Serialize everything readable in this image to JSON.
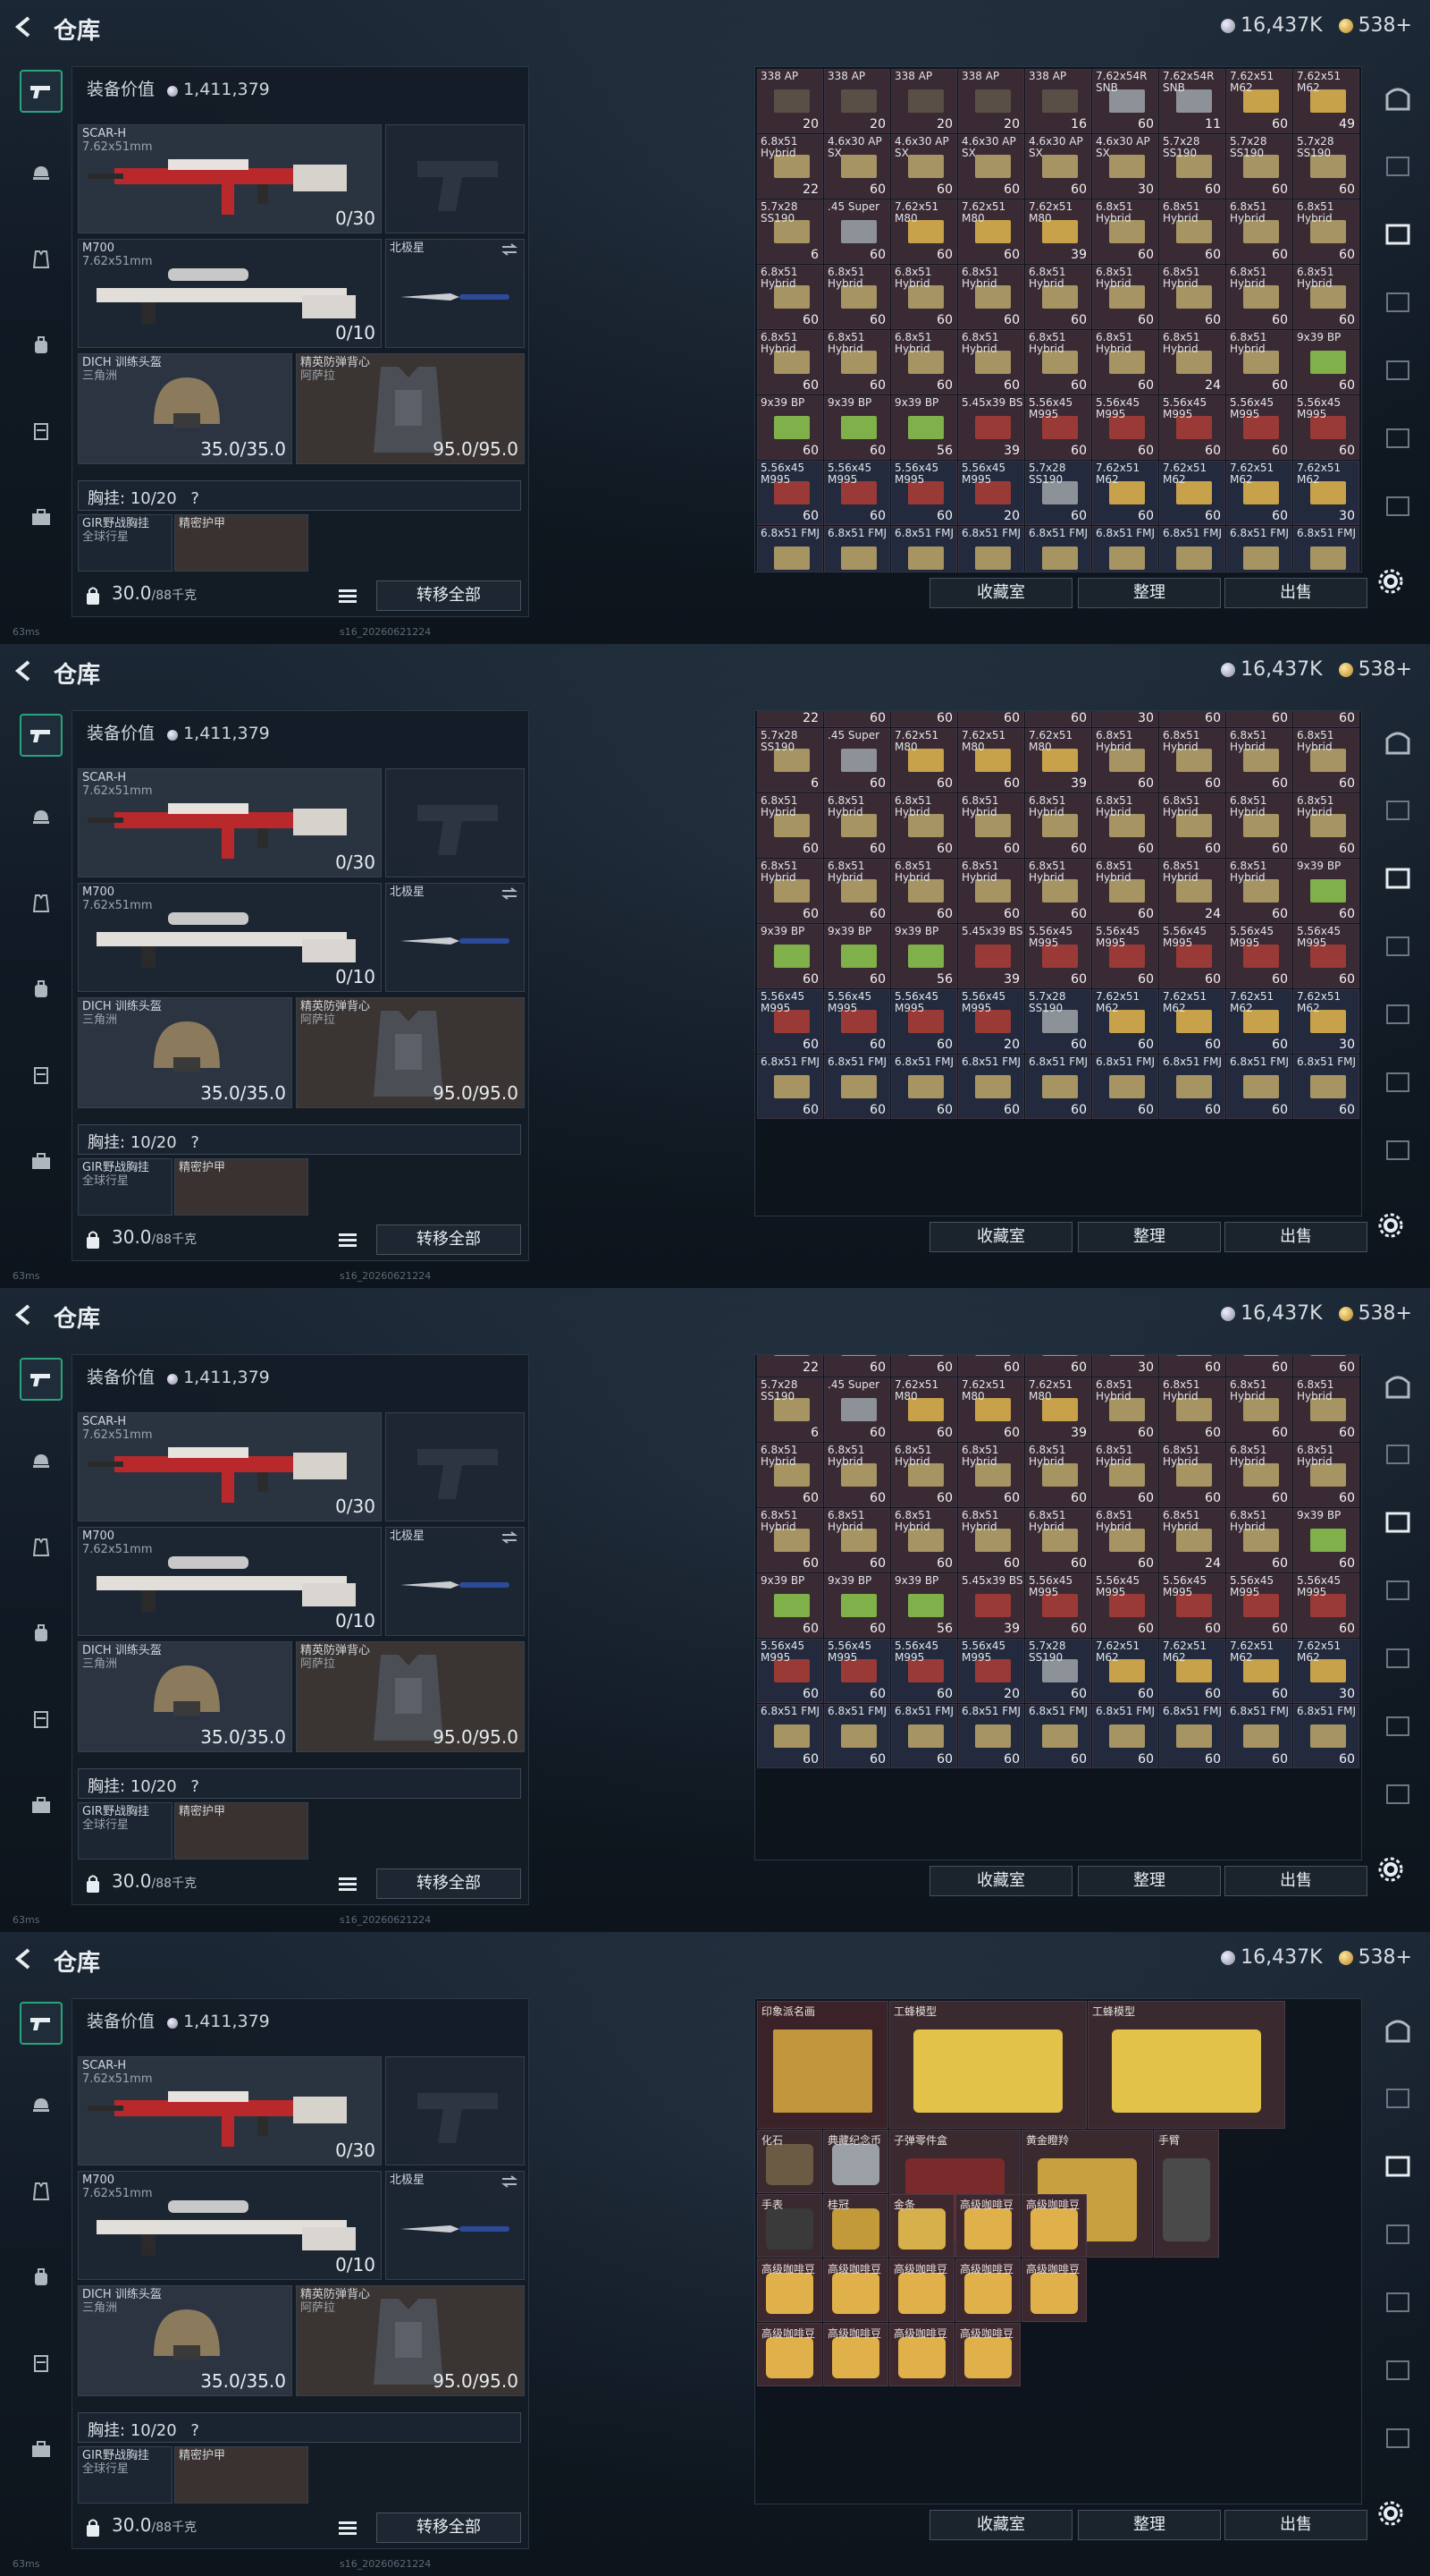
{
  "app": {
    "title": "仓库",
    "currency_silver": "16,437K",
    "currency_gold": "538+"
  },
  "loadout": {
    "value_label": "装备价值",
    "value": "1,411,379",
    "primary": {
      "name": "SCAR-H",
      "caliber": "7.62x51mm",
      "ammo": "0/30"
    },
    "secondary": {
      "name": "M700",
      "caliber": "7.62x51mm",
      "ammo": "0/10"
    },
    "melee": {
      "name": "北极星"
    },
    "helmet": {
      "name": "DICH 训练头盔",
      "sub": "三角洲",
      "durability": "35.0/35.0"
    },
    "armor": {
      "name": "精英防弹背心",
      "sub": "阿萨拉",
      "durability": "95.0/95.0"
    },
    "chest": {
      "label": "胸挂:",
      "value": "10/20",
      "help": "?"
    },
    "rig_item_1": "GIR野战胸挂",
    "rig_item_1_sub": "全球行星",
    "rig_item_2": "精密护甲",
    "weight": "30.0",
    "weight_max": "/88千克",
    "transfer_all": "转移全部"
  },
  "inventory_buttons": {
    "collect": "收藏室",
    "sort": "整理",
    "sell": "出售"
  },
  "status": {
    "ping": "63ms",
    "build": "s16_20260621224"
  },
  "panels": [
    {
      "rows": [
        [
          [
            "338 AP",
            "20",
            "ap"
          ],
          [
            "338 AP",
            "20",
            "ap"
          ],
          [
            "338 AP",
            "20",
            "ap"
          ],
          [
            "338 AP",
            "20",
            "ap"
          ],
          [
            "338 AP",
            "16",
            "ap"
          ],
          [
            "7.62x54R SNB",
            "60",
            "silver"
          ],
          [
            "7.62x54R SNB",
            "11",
            "silver"
          ],
          [
            "7.62x51 M62",
            "60",
            "gold"
          ],
          [
            "7.62x51 M62",
            "49",
            "gold"
          ]
        ],
        [
          [
            "6.8x51 Hybrid",
            "22",
            "tan"
          ],
          [
            "4.6x30 AP SX",
            "60",
            "tan"
          ],
          [
            "4.6x30 AP SX",
            "60",
            "tan"
          ],
          [
            "4.6x30 AP SX",
            "60",
            "tan"
          ],
          [
            "4.6x30 AP SX",
            "60",
            "tan"
          ],
          [
            "4.6x30 AP SX",
            "30",
            "tan"
          ],
          [
            "5.7x28 SS190",
            "60",
            "tan"
          ],
          [
            "5.7x28 SS190",
            "60",
            "tan"
          ],
          [
            "5.7x28 SS190",
            "60",
            "tan"
          ]
        ],
        [
          [
            "5.7x28 SS190",
            "6",
            "tan"
          ],
          [
            ".45 Super",
            "60",
            "silver"
          ],
          [
            "7.62x51 M80",
            "60",
            "gold"
          ],
          [
            "7.62x51 M80",
            "60",
            "gold"
          ],
          [
            "7.62x51 M80",
            "39",
            "gold"
          ],
          [
            "6.8x51 Hybrid",
            "60",
            "tan"
          ],
          [
            "6.8x51 Hybrid",
            "60",
            "tan"
          ],
          [
            "6.8x51 Hybrid",
            "60",
            "tan"
          ],
          [
            "6.8x51 Hybrid",
            "60",
            "tan"
          ]
        ],
        [
          [
            "6.8x51 Hybrid",
            "60",
            "tan"
          ],
          [
            "6.8x51 Hybrid",
            "60",
            "tan"
          ],
          [
            "6.8x51 Hybrid",
            "60",
            "tan"
          ],
          [
            "6.8x51 Hybrid",
            "60",
            "tan"
          ],
          [
            "6.8x51 Hybrid",
            "60",
            "tan"
          ],
          [
            "6.8x51 Hybrid",
            "60",
            "tan"
          ],
          [
            "6.8x51 Hybrid",
            "60",
            "tan"
          ],
          [
            "6.8x51 Hybrid",
            "60",
            "tan"
          ],
          [
            "6.8x51 Hybrid",
            "60",
            "tan"
          ]
        ],
        [
          [
            "6.8x51 Hybrid",
            "60",
            "tan"
          ],
          [
            "6.8x51 Hybrid",
            "60",
            "tan"
          ],
          [
            "6.8x51 Hybrid",
            "60",
            "tan"
          ],
          [
            "6.8x51 Hybrid",
            "60",
            "tan"
          ],
          [
            "6.8x51 Hybrid",
            "60",
            "tan"
          ],
          [
            "6.8x51 Hybrid",
            "60",
            "tan"
          ],
          [
            "6.8x51 Hybrid",
            "24",
            "tan"
          ],
          [
            "6.8x51 Hybrid",
            "60",
            "tan"
          ],
          [
            "9x39 BP",
            "60",
            "green"
          ]
        ],
        [
          [
            "9x39 BP",
            "60",
            "green"
          ],
          [
            "9x39 BP",
            "60",
            "green"
          ],
          [
            "9x39 BP",
            "56",
            "green"
          ],
          [
            "5.45x39 BS",
            "39",
            "red"
          ],
          [
            "5.56x45 M995",
            "60",
            "red"
          ],
          [
            "5.56x45 M995",
            "60",
            "red"
          ],
          [
            "5.56x45 M995",
            "60",
            "red"
          ],
          [
            "5.56x45 M995",
            "60",
            "red"
          ],
          [
            "5.56x45 M995",
            "60",
            "red"
          ]
        ],
        [
          [
            "5.56x45 M995",
            "60",
            "red"
          ],
          [
            "5.56x45 M995",
            "60",
            "red"
          ],
          [
            "5.56x45 M995",
            "60",
            "red"
          ],
          [
            "5.56x45 M995",
            "20",
            "red"
          ],
          [
            "5.7x28 SS190",
            "60",
            "silver"
          ],
          [
            "7.62x51 M62",
            "60",
            "gold"
          ],
          [
            "7.62x51 M62",
            "60",
            "gold"
          ],
          [
            "7.62x51 M62",
            "60",
            "gold"
          ],
          [
            "7.62x51 M62",
            "30",
            "gold"
          ]
        ],
        [
          [
            "6.8x51 FMJ",
            "60",
            "tan"
          ],
          [
            "6.8x51 FMJ",
            "60",
            "tan"
          ],
          [
            "6.8x51 FMJ",
            "60",
            "tan"
          ],
          [
            "6.8x51 FMJ",
            "60",
            "tan"
          ],
          [
            "6.8x51 FMJ",
            "60",
            "tan"
          ],
          [
            "6.8x51 FMJ",
            "60",
            "tan"
          ],
          [
            "6.8x51 FMJ",
            "60",
            "tan"
          ],
          [
            "6.8x51 FMJ",
            "60",
            "tan"
          ],
          [
            "6.8x51 FMJ",
            "60",
            "tan"
          ]
        ]
      ]
    }
  ],
  "collectibles": [
    {
      "name": "印象派名画"
    },
    {
      "name": "工蜂模型"
    },
    {
      "name": "工蜂模型"
    },
    {
      "name": "子弹零件盒"
    },
    {
      "name": "黄金瞪羚"
    },
    {
      "name": "手臂"
    },
    {
      "name": "化石"
    },
    {
      "name": "典藏纪念币"
    },
    {
      "name": "手表"
    },
    {
      "name": "桂冠"
    },
    {
      "name": "金条"
    },
    {
      "name": "高级咖啡豆"
    },
    {
      "name": "高级咖啡豆"
    },
    {
      "name": "高级咖啡豆"
    },
    {
      "name": "高级咖啡豆"
    },
    {
      "name": "高级咖啡豆"
    },
    {
      "name": "高级咖啡豆"
    },
    {
      "name": "高级咖啡豆"
    },
    {
      "name": "高级咖啡豆"
    },
    {
      "name": "高级咖啡豆"
    },
    {
      "name": "高级咖啡豆"
    },
    {
      "name": "高级咖啡豆"
    }
  ],
  "colors": {
    "ap": "#5a4f46",
    "silver": "#8d9299",
    "gold": "#c7a24a",
    "tan": "#a69562",
    "green": "#7fb04a",
    "red": "#9a3a36",
    "cell_bg_red": "#3a2a33",
    "cell_bg_blue": "#232a3d"
  }
}
